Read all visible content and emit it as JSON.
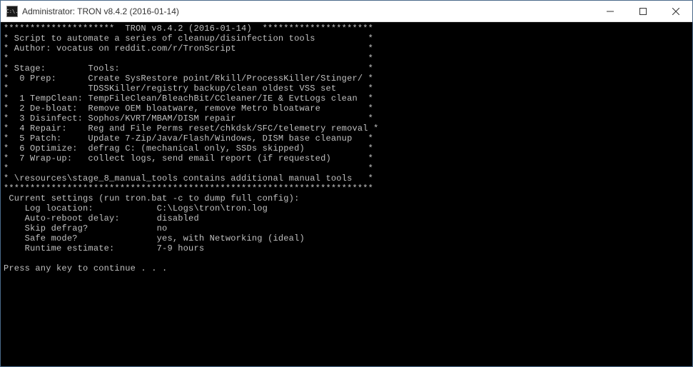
{
  "titlebar": {
    "icon_label": "C:\\.",
    "text": "Administrator:  TRON v8.4.2 (2016-01-14)"
  },
  "header": {
    "border_top": "*********************  TRON v8.4.2 (2016-01-14)  *********************",
    "line1": "* Script to automate a series of cleanup/disinfection tools          *",
    "line2": "* Author: vocatus on reddit.com/r/TronScript                         *",
    "blank": "*                                                                    *",
    "stage_header": "* Stage:        Tools:                                               *",
    "stage0": "*  0 Prep:      Create SysRestore point/Rkill/ProcessKiller/Stinger/ *",
    "stage0b": "*               TDSSKiller/registry backup/clean oldest VSS set      *",
    "stage1": "*  1 TempClean: TempFileClean/BleachBit/CCleaner/IE & EvtLogs clean  *",
    "stage2": "*  2 De-bloat:  Remove OEM bloatware, remove Metro bloatware         *",
    "stage3": "*  3 Disinfect: Sophos/KVRT/MBAM/DISM repair                         *",
    "stage4": "*  4 Repair:    Reg and File Perms reset/chkdsk/SFC/telemetry removal *",
    "stage5": "*  5 Patch:     Update 7-Zip/Java/Flash/Windows, DISM base cleanup   *",
    "stage6": "*  6 Optimize:  defrag C: (mechanical only, SSDs skipped)            *",
    "stage7": "*  7 Wrap-up:   collect logs, send email report (if requested)       *",
    "resources": "* \\resources\\stage_8_manual_tools contains additional manual tools   *",
    "border_bottom": "**********************************************************************"
  },
  "settings": {
    "heading": " Current settings (run tron.bat -c to dump full config):",
    "log_label": "    Log location:            ",
    "log_value": "C:\\Logs\\tron\\tron.log",
    "reboot_label": "    Auto-reboot delay:       ",
    "reboot_value": "disabled",
    "defrag_label": "    Skip defrag?             ",
    "defrag_value": "no",
    "safe_label": "    Safe mode?               ",
    "safe_value": "yes, with Networking (ideal)",
    "runtime_label": "    Runtime estimate:        ",
    "runtime_value": "7-9 hours"
  },
  "prompt": "Press any key to continue . . ."
}
